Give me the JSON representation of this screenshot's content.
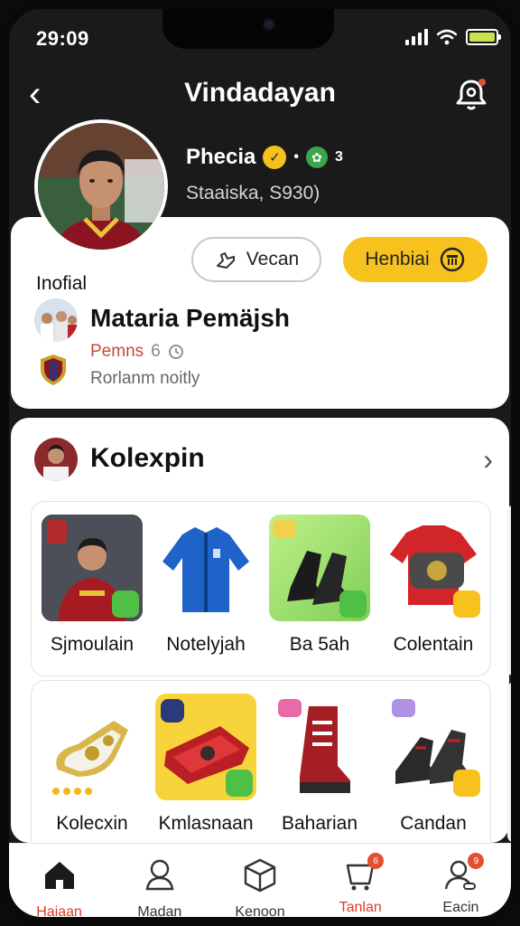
{
  "status_bar": {
    "time": "29:09"
  },
  "header": {
    "title": "Vindadayan"
  },
  "profile": {
    "name": "Phecia",
    "badge_extra": "3",
    "subtitle": "Staaiska, S930)"
  },
  "actions": {
    "outline_label": "Vecan",
    "primary_label": "Henbiai"
  },
  "club": {
    "official_label": "Inofial",
    "title": "Mataria Pemäjsh",
    "red_text": "Pemns",
    "red_num": "6",
    "note": "Rorlanm noitly"
  },
  "collection": {
    "title": "Kolexpin",
    "row1": [
      {
        "label": "Sjmoulain",
        "icon": "player-card-icon"
      },
      {
        "label": "Notelyjah",
        "icon": "jacket-icon"
      },
      {
        "label": "Ba 5ah",
        "icon": "boots-icon"
      },
      {
        "label": "Colentain",
        "icon": "shirt-icon"
      }
    ],
    "row2": [
      {
        "label": "Kolecxin",
        "icon": "gold-boot-icon"
      },
      {
        "label": "Kmlasnaan",
        "icon": "red-wallet-icon"
      },
      {
        "label": "Baharian",
        "icon": "red-boot-icon"
      },
      {
        "label": "Candan",
        "icon": "dark-boot-icon"
      }
    ]
  },
  "tabs": [
    {
      "label": "Haiaan",
      "icon": "home-icon"
    },
    {
      "label": "Madan",
      "icon": "profile-icon"
    },
    {
      "label": "Kenoon",
      "icon": "box-icon"
    },
    {
      "label": "Tanlan",
      "icon": "cart-icon",
      "badge": "6"
    },
    {
      "label": "Eacin",
      "icon": "user-settings-icon",
      "badge": "9"
    }
  ],
  "colors": {
    "accent_yellow": "#f7c21d",
    "accent_red": "#d93b28",
    "dark_bg": "#1a1a1a"
  }
}
